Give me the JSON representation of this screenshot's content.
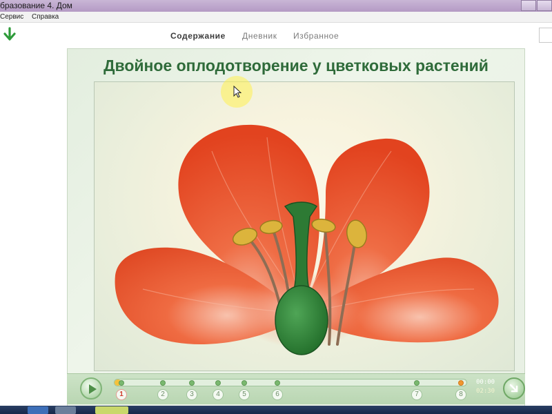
{
  "window": {
    "title": "бразование 4. Дом"
  },
  "menu": {
    "items": [
      "Сервис",
      "Справка"
    ]
  },
  "toolbar": {
    "tabs": [
      {
        "label": "Содержание",
        "active": true
      },
      {
        "label": "Дневник",
        "active": false
      },
      {
        "label": "Избранное",
        "active": false
      }
    ],
    "download_icon": "green-down-arrow-icon"
  },
  "slide": {
    "title": "Двойное оплодотворение у цветковых растений"
  },
  "player": {
    "progress_fraction": 0.02,
    "steps": [
      "1",
      "2",
      "3",
      "4",
      "5",
      "6",
      "7",
      "8"
    ],
    "current_step": "1",
    "time_current": "00:00",
    "time_total": "02:30"
  },
  "colors": {
    "title_green": "#2f6b3a",
    "petal_orange": "#ee5b30",
    "pistil_green": "#2f7d36",
    "anther_yellow": "#d9b63a"
  }
}
